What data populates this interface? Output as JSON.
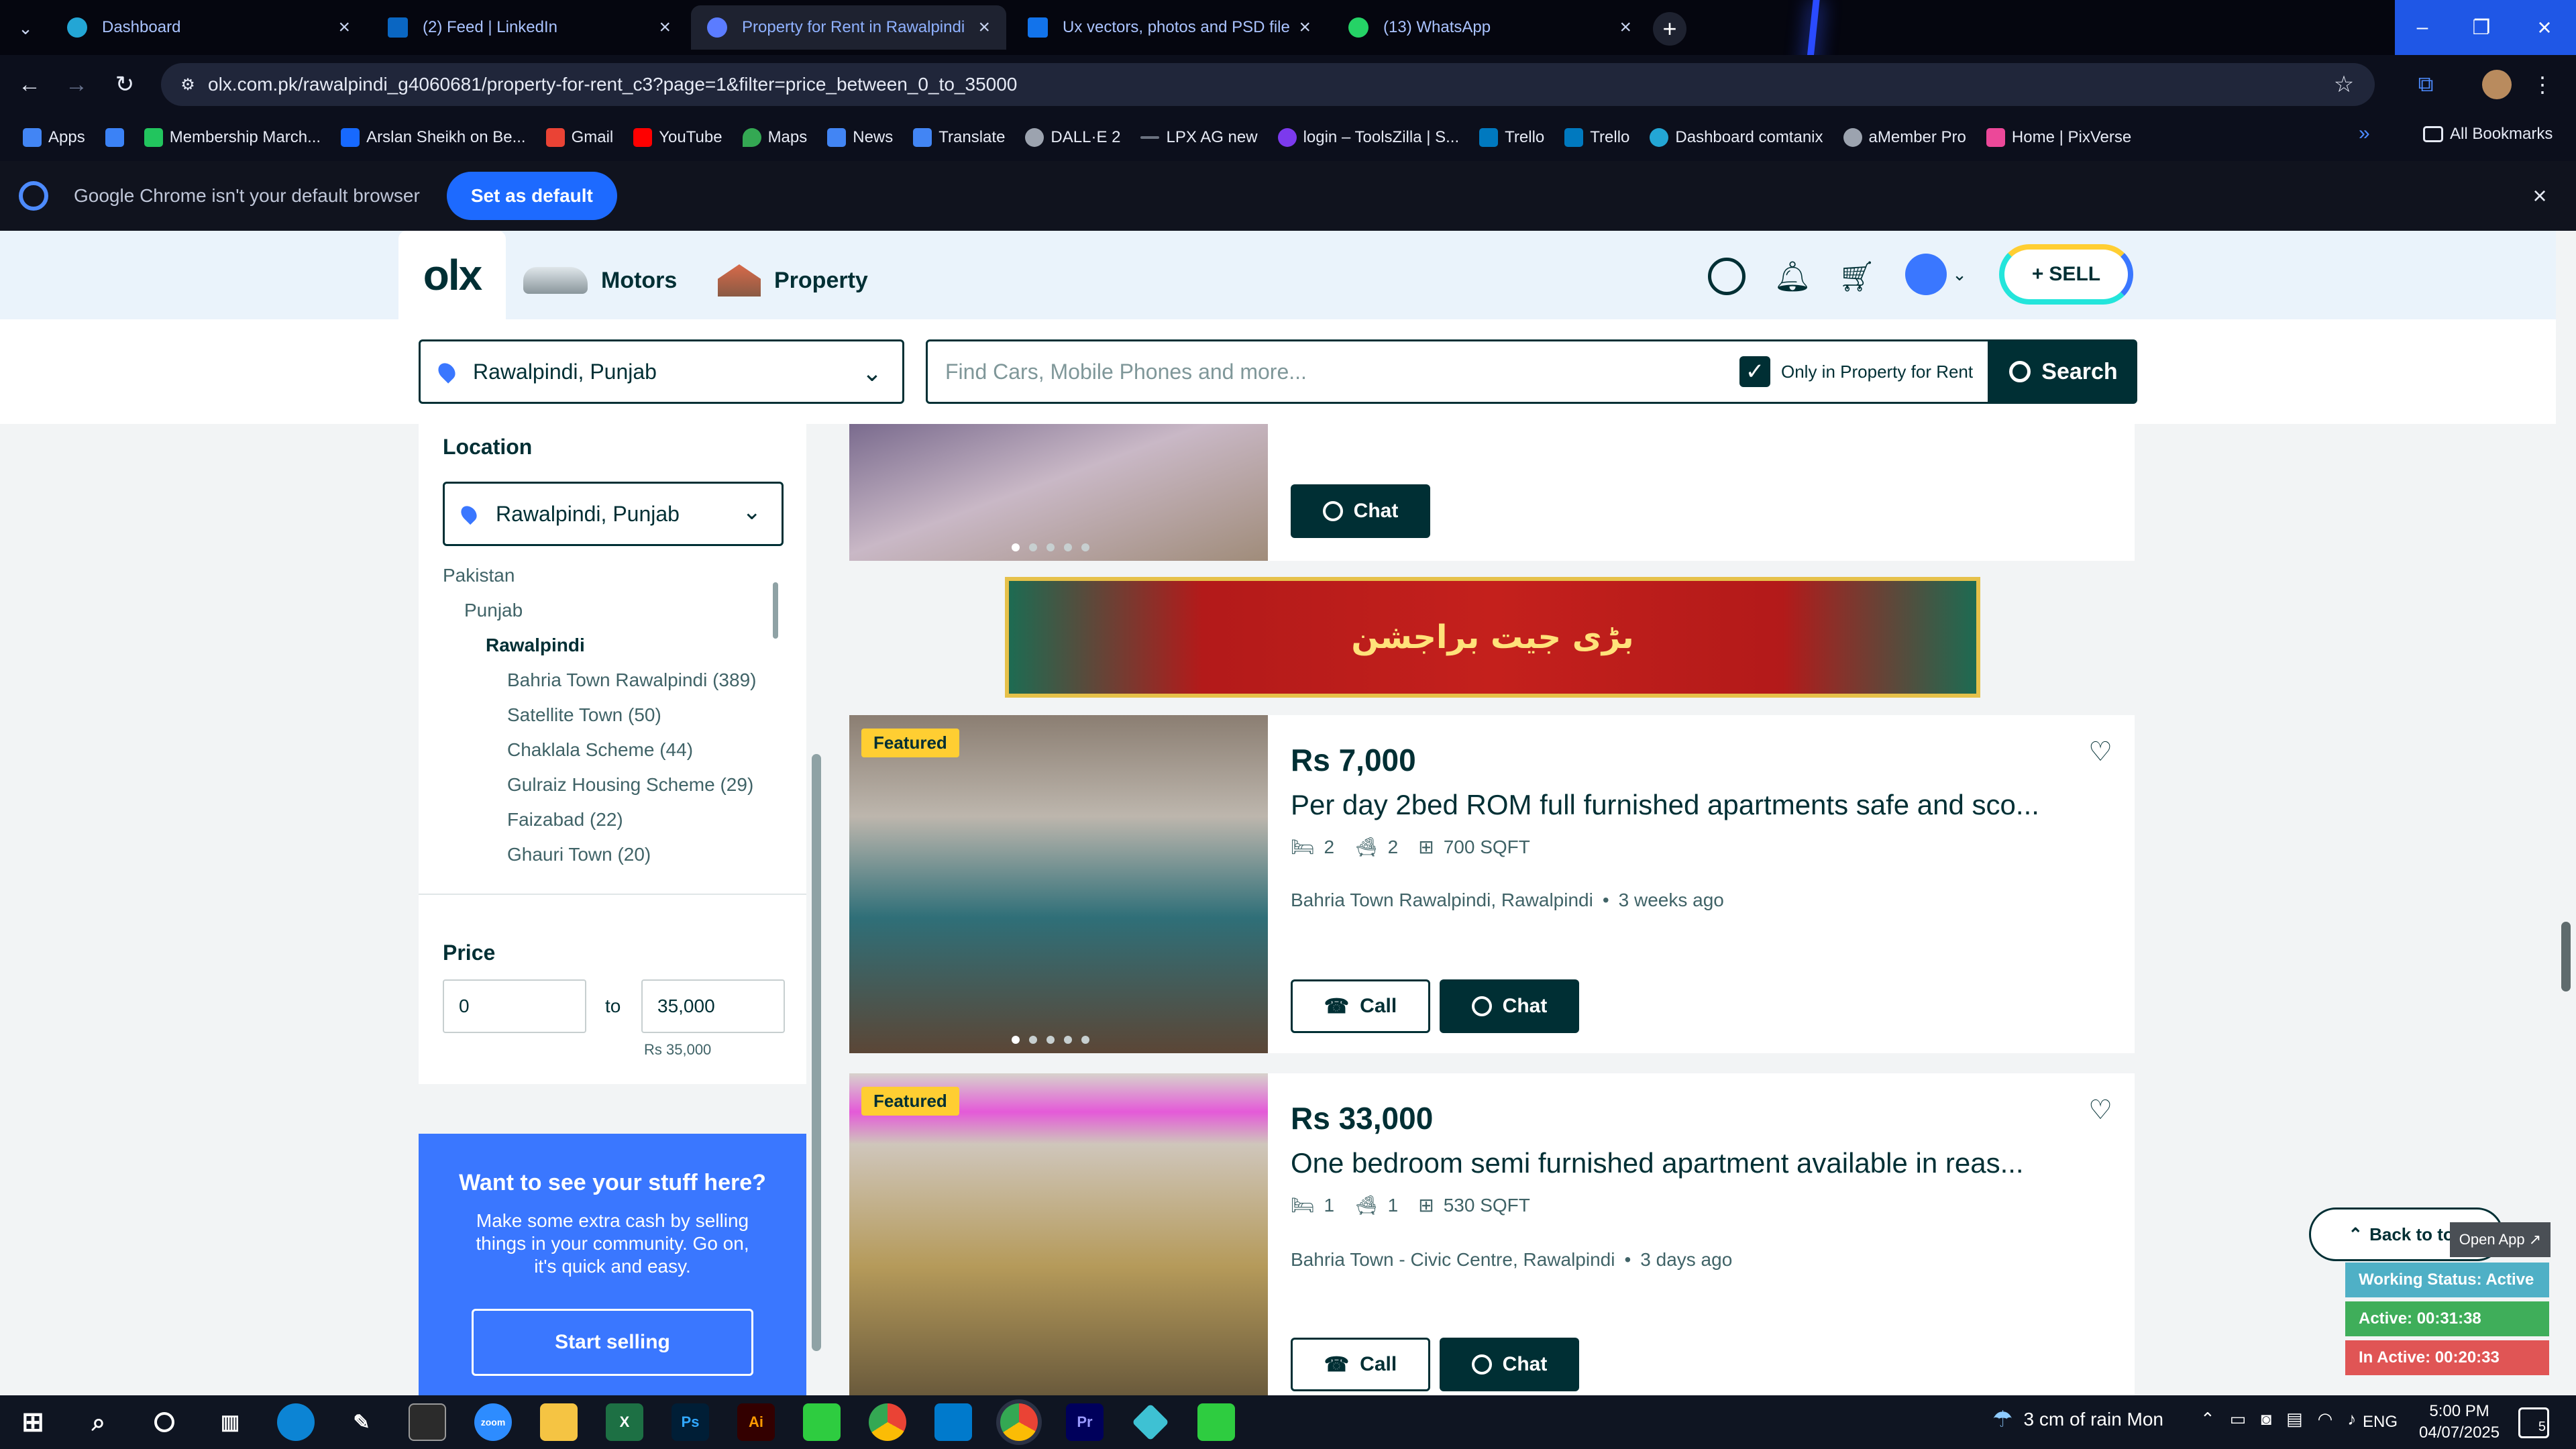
{
  "browser": {
    "tabs": [
      {
        "title": "Dashboard",
        "color": "#23a6d5"
      },
      {
        "title": "(2) Feed | LinkedIn",
        "color": "#0a66c2"
      },
      {
        "title": "Property for Rent in Rawalpindi",
        "color": "#5b7cff"
      },
      {
        "title": "Ux vectors, photos and PSD file",
        "color": "#1273eb"
      },
      {
        "title": "(13) WhatsApp",
        "color": "#25d366"
      }
    ],
    "url": "olx.com.pk/rawalpindi_g4060681/property-for-rent_c3?page=1&filter=price_between_0_to_35000",
    "bookmarks": [
      {
        "label": "Apps",
        "color": "#4285f4"
      },
      {
        "label": "",
        "color": "#3b82f6"
      },
      {
        "label": "Membership March...",
        "color": "#22c55e"
      },
      {
        "label": "Arslan Sheikh on Be...",
        "color": "#1769ff"
      },
      {
        "label": "Gmail",
        "color": "#ea4335"
      },
      {
        "label": "YouTube",
        "color": "#ff0000"
      },
      {
        "label": "Maps",
        "color": "#34a853"
      },
      {
        "label": "News",
        "color": "#4285f4"
      },
      {
        "label": "Translate",
        "color": "#4285f4"
      },
      {
        "label": "DALL·E 2",
        "color": "#9ca3af"
      },
      {
        "label": "LPX AG new",
        "color": "#6b7280"
      },
      {
        "label": "login – ToolsZilla | S...",
        "color": "#7c3aed"
      },
      {
        "label": "Trello",
        "color": "#0079bf"
      },
      {
        "label": "Trello",
        "color": "#0079bf"
      },
      {
        "label": "Dashboard comtanix",
        "color": "#23a6d5"
      },
      {
        "label": "aMember Pro",
        "color": "#9ca3af"
      },
      {
        "label": "Home | PixVerse",
        "color": "#ec4899"
      }
    ],
    "all_bookmarks": "All Bookmarks",
    "infobar_text": "Google Chrome isn't your default browser",
    "set_default": "Set as default"
  },
  "olx": {
    "logo": "olx",
    "nav": [
      "Motors",
      "Property"
    ],
    "sell": "SELL",
    "location": "Rawalpindi, Punjab",
    "search_placeholder": "Find Cars, Mobile Phones and more...",
    "only_in": "Only in Property for Rent",
    "search_btn": "Search"
  },
  "sidebar": {
    "location_heading": "Location",
    "location_value": "Rawalpindi, Punjab",
    "tree": [
      {
        "label": "Pakistan",
        "level": 0,
        "bold": false
      },
      {
        "label": "Punjab",
        "level": 1,
        "bold": false
      },
      {
        "label": "Rawalpindi",
        "level": 2,
        "bold": true
      },
      {
        "label": "Bahria Town Rawalpindi (389)",
        "level": 3,
        "bold": false
      },
      {
        "label": "Satellite Town (50)",
        "level": 3,
        "bold": false
      },
      {
        "label": "Chaklala Scheme (44)",
        "level": 3,
        "bold": false
      },
      {
        "label": "Gulraiz Housing Scheme (29)",
        "level": 3,
        "bold": false
      },
      {
        "label": "Faizabad (22)",
        "level": 3,
        "bold": false
      },
      {
        "label": "Ghauri Town (20)",
        "level": 3,
        "bold": false
      }
    ],
    "price_heading": "Price",
    "price_min": "0",
    "price_to": "to",
    "price_max": "35,000",
    "price_hint": "Rs 35,000",
    "promo_title": "Want to see your stuff here?",
    "promo_text": "Make some extra cash by selling things in your community. Go on, it's quick and easy.",
    "promo_button": "Start selling"
  },
  "listings": {
    "top_chat": "Chat",
    "ad_banner_text": "بڑی جیت براجشن",
    "items": [
      {
        "featured": "Featured",
        "price": "Rs 7,000",
        "title": "Per day 2bed ROM full furnished apartments safe and sco...",
        "beds": "2",
        "baths": "2",
        "area": "700 SQFT",
        "location": "Bahria Town Rawalpindi, Rawalpindi",
        "time": "3 weeks ago",
        "call": "Call",
        "chat": "Chat"
      },
      {
        "featured": "Featured",
        "price": "Rs 33,000",
        "title": "One bedroom semi furnished apartment available in reas...",
        "beds": "1",
        "baths": "1",
        "area": "530 SQFT",
        "location": "Bahria Town - Civic Centre, Rawalpindi",
        "time": "3 days ago",
        "call": "Call",
        "chat": "Chat"
      }
    ]
  },
  "overlay": {
    "back_to_top": "Back to top",
    "open_app": "Open App ↗",
    "working_status": "Working Status: Active",
    "active": "Active: 00:31:38",
    "inactive": "In Active: 00:20:33"
  },
  "taskbar": {
    "weather": "3 cm of rain Mon",
    "lang": "ENG",
    "time": "5:00 PM",
    "date": "04/07/2025",
    "notif_count": "5"
  }
}
